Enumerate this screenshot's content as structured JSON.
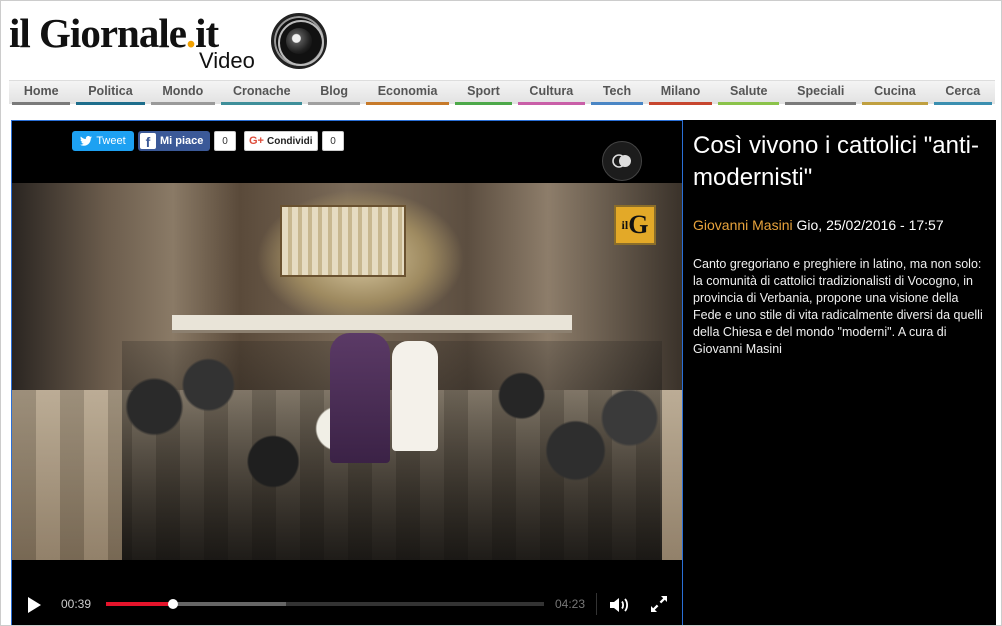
{
  "header": {
    "logo_main": "il Giornale",
    "logo_dot": ".",
    "logo_tld": "it",
    "logo_sub": "Video"
  },
  "nav": {
    "items": [
      {
        "label": "Home",
        "color": "#7a7a7a"
      },
      {
        "label": "Politica",
        "color": "#1e6e8c"
      },
      {
        "label": "Mondo",
        "color": "#9a9a9a"
      },
      {
        "label": "Cronache",
        "color": "#3f8f9a"
      },
      {
        "label": "Blog",
        "color": "#a0a0a0"
      },
      {
        "label": "Economia",
        "color": "#c77a2a"
      },
      {
        "label": "Sport",
        "color": "#4da94a"
      },
      {
        "label": "Cultura",
        "color": "#c95fa8"
      },
      {
        "label": "Tech",
        "color": "#4a86c5"
      },
      {
        "label": "Milano",
        "color": "#c7462f"
      },
      {
        "label": "Salute",
        "color": "#8bc34a"
      },
      {
        "label": "Speciali",
        "color": "#7a7a7a"
      },
      {
        "label": "Cucina",
        "color": "#c0a040"
      },
      {
        "label": "Cerca",
        "color": "#3b8fb0"
      }
    ]
  },
  "share": {
    "tweet_label": "Tweet",
    "like_label": "Mi piace",
    "like_count": "0",
    "share_label": "Condividi",
    "share_count": "0"
  },
  "player": {
    "current_time": "00:39",
    "duration": "04:23",
    "progress": 0.154,
    "buffered": 0.41,
    "overlay_logo_small": "il",
    "overlay_logo_big": "G"
  },
  "article": {
    "title": "Così vivono i cattolici \"anti-modernisti\"",
    "author": "Giovanni Masini",
    "date": "Gio, 25/02/2016 - 17:57",
    "description": "Canto gregoriano e preghiere in latino, ma non solo: la comunità di cattolici tradizionalisti di Vocogno, in provincia di Verbania, propone una visione della Fede e uno stile di vita radicalmente diversi da quelli della Chiesa e del mondo \"moderni\". A cura di Giovanni Masini"
  },
  "icons": {
    "play": "play-icon",
    "volume": "volume-icon",
    "fullscreen": "fullscreen-icon",
    "eye": "eye-icon",
    "twitter": "twitter-icon",
    "facebook": "facebook-icon",
    "google_plus": "google-plus-icon",
    "camera": "camera-lens-icon"
  }
}
